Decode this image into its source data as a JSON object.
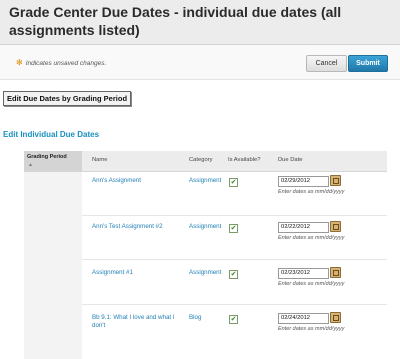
{
  "page": {
    "title": "Grade Center Due Dates - individual due dates (all assignments listed)"
  },
  "action_bar": {
    "note_icon": "asterisk-icon",
    "note_text": "Indicates unsaved changes.",
    "cancel_label": "Cancel",
    "submit_label": "Submit"
  },
  "grading_period_button": "Edit Due Dates by Grading Period",
  "section_title": "Edit Individual Due Dates",
  "table": {
    "headers": {
      "grading_period": "Grading Period",
      "name": "Name",
      "category": "Category",
      "available": "Is Available?",
      "due_date": "Due Date"
    },
    "rows": [
      {
        "name": "Ann's Assignment",
        "category": "Assignment",
        "available": true,
        "due_date": "02/29/2012",
        "hint": "Enter dates as mm/dd/yyyy"
      },
      {
        "name": "Ann's Test Assignment #2",
        "category": "Assignment",
        "available": true,
        "due_date": "02/22/2012",
        "hint": "Enter dates as mm/dd/yyyy"
      },
      {
        "name": "Assignment #1",
        "category": "Assignment",
        "available": true,
        "due_date": "02/23/2012",
        "hint": "Enter dates as mm/dd/yyyy"
      },
      {
        "name": "Bb 9.1: What I love and what I don't",
        "category": "Blog",
        "available": true,
        "due_date": "02/24/2012",
        "hint": "Enter dates as mm/dd/yyyy"
      }
    ]
  },
  "colors": {
    "accent": "#1a8fc1",
    "submit": "#1f78a8",
    "link": "#1f7fb5"
  }
}
